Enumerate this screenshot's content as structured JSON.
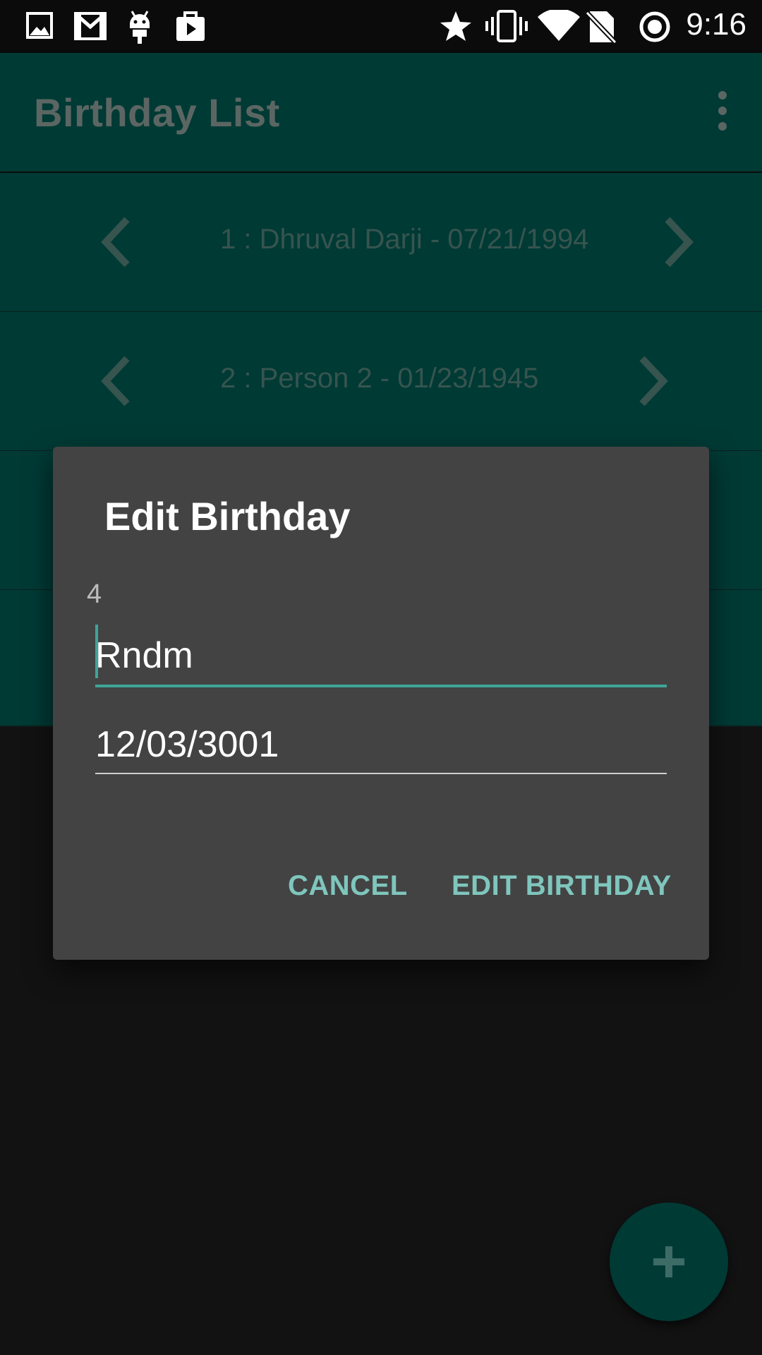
{
  "status_bar": {
    "time": "9:16",
    "left_icons": [
      "gallery-icon",
      "gmail-icon",
      "android-debug-icon",
      "play-store-icon"
    ],
    "right_icons": [
      "star-icon",
      "vibrate-icon",
      "wifi-icon",
      "no-sim-icon",
      "sync-icon"
    ]
  },
  "app_bar": {
    "title": "Birthday List",
    "overflow_icon": "more-vertical-icon"
  },
  "list": {
    "items": [
      {
        "text": "1 : Dhruval Darji - 07/21/1994"
      },
      {
        "text": "2 : Person 2 - 01/23/1945"
      }
    ]
  },
  "dialog": {
    "title": "Edit Birthday",
    "id_label": "4",
    "name_value": "Rndm",
    "date_value": "12/03/3001",
    "cancel_label": "CANCEL",
    "confirm_label": "EDIT BIRTHDAY"
  },
  "fab": {
    "icon": "plus-icon"
  },
  "colors": {
    "primary_dark": "#003a35",
    "accent": "#7fc6bd",
    "dialog_bg": "#434343",
    "background": "#121212"
  }
}
